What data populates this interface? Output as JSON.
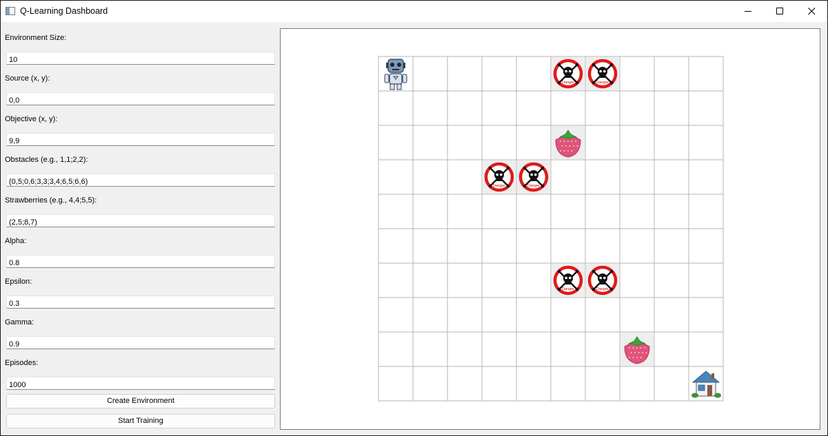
{
  "window": {
    "title": "Q-Learning Dashboard"
  },
  "form": {
    "env_size_label": "Environment Size:",
    "env_size_value": "10",
    "source_label": "Source (x, y):",
    "source_value": "0,0",
    "objective_label": "Objective (x, y):",
    "objective_value": "9,9",
    "obstacles_label": "Obstacles (e.g., 1,1;2,2):",
    "obstacles_value": "(0,5;0,6;3,3;3,4;6,5;6,6)",
    "strawberries_label": "Strawberries (e.g., 4,4;5,5):",
    "strawberries_value": "(2,5;8,7)",
    "alpha_label": "Alpha:",
    "alpha_value": "0.8",
    "epsilon_label": "Epsilon:",
    "epsilon_value": "0.3",
    "gamma_label": "Gamma:",
    "gamma_value": "0.9",
    "episodes_label": "Episodes:",
    "episodes_value": "1000",
    "create_button": "Create Environment",
    "train_button": "Start Training"
  },
  "grid": {
    "size": 10,
    "agent": [
      0,
      0
    ],
    "goal": [
      9,
      9
    ],
    "obstacles": [
      [
        0,
        5
      ],
      [
        0,
        6
      ],
      [
        3,
        3
      ],
      [
        3,
        4
      ],
      [
        6,
        5
      ],
      [
        6,
        6
      ]
    ],
    "strawberries": [
      [
        2,
        5
      ],
      [
        8,
        7
      ]
    ],
    "danger_text": "Danger",
    "line_color": "#b4b4b4",
    "obstacle_color": "#e01a1a",
    "strawberry_color": "#e0557a"
  }
}
